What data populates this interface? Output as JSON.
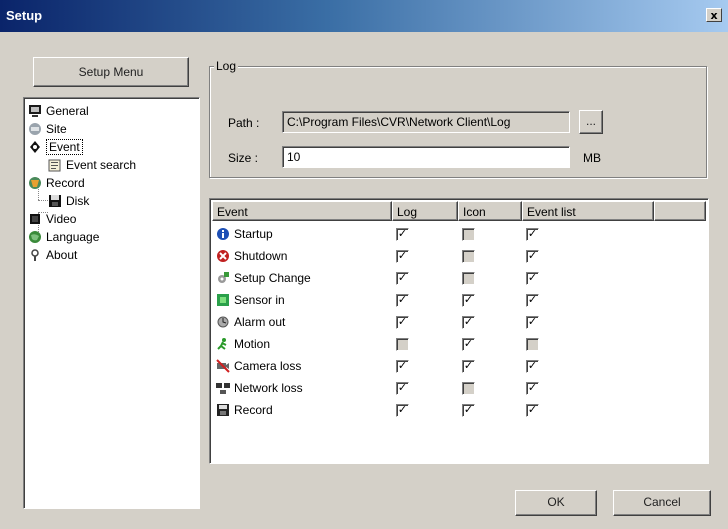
{
  "window": {
    "title": "Setup",
    "close_glyph": "x"
  },
  "setup_menu": {
    "label": "Setup Menu"
  },
  "tree": [
    {
      "label": "General",
      "icon": "monitor-icon",
      "indent": 0
    },
    {
      "label": "Site",
      "icon": "site-icon",
      "indent": 0
    },
    {
      "label": "Event",
      "icon": "event-icon",
      "indent": 0,
      "selected": true
    },
    {
      "label": "Event search",
      "icon": "event-search-icon",
      "indent": 1
    },
    {
      "label": "Record",
      "icon": "record-icon",
      "indent": 0
    },
    {
      "label": "Disk",
      "icon": "disk-icon",
      "indent": 1
    },
    {
      "label": "Video",
      "icon": "video-icon",
      "indent": 0
    },
    {
      "label": "Language",
      "icon": "globe-icon",
      "indent": 0
    },
    {
      "label": "About",
      "icon": "about-icon",
      "indent": 0
    }
  ],
  "log": {
    "group_label": "Log",
    "path_label": "Path :",
    "path_value": "C:\\Program Files\\CVR\\Network Client\\Log",
    "browse_label": "...",
    "size_label": "Size :",
    "size_value": "10",
    "size_unit": "MB"
  },
  "event_list": {
    "columns": [
      "Event",
      "Log",
      "Icon",
      "Event list",
      ""
    ],
    "rows": [
      {
        "name": "Startup",
        "icon": "info-icon",
        "log": true,
        "icon_col": false,
        "event_list": true,
        "log_enabled": true,
        "icon_enabled": false,
        "list_enabled": true
      },
      {
        "name": "Shutdown",
        "icon": "shutdown-icon",
        "log": true,
        "icon_col": false,
        "event_list": true,
        "log_enabled": true,
        "icon_enabled": false,
        "list_enabled": true
      },
      {
        "name": "Setup Change",
        "icon": "setup-change-icon",
        "log": true,
        "icon_col": false,
        "event_list": true,
        "log_enabled": true,
        "icon_enabled": false,
        "list_enabled": true
      },
      {
        "name": "Sensor in",
        "icon": "sensor-icon",
        "log": true,
        "icon_col": true,
        "event_list": true,
        "log_enabled": true,
        "icon_enabled": true,
        "list_enabled": true
      },
      {
        "name": "Alarm out",
        "icon": "alarm-icon",
        "log": true,
        "icon_col": true,
        "event_list": true,
        "log_enabled": true,
        "icon_enabled": true,
        "list_enabled": true
      },
      {
        "name": "Motion",
        "icon": "motion-icon",
        "log": false,
        "icon_col": true,
        "event_list": false,
        "log_enabled": false,
        "icon_enabled": true,
        "list_enabled": false
      },
      {
        "name": "Camera loss",
        "icon": "camera-loss-icon",
        "log": true,
        "icon_col": true,
        "event_list": true,
        "log_enabled": true,
        "icon_enabled": true,
        "list_enabled": true
      },
      {
        "name": "Network loss",
        "icon": "network-loss-icon",
        "log": true,
        "icon_col": false,
        "event_list": true,
        "log_enabled": true,
        "icon_enabled": false,
        "list_enabled": true
      },
      {
        "name": "Record",
        "icon": "record-disk-icon",
        "log": true,
        "icon_col": true,
        "event_list": true,
        "log_enabled": true,
        "icon_enabled": true,
        "list_enabled": true
      }
    ]
  },
  "buttons": {
    "ok": "OK",
    "cancel": "Cancel"
  },
  "colors": {
    "window_bg": "#d4d0c8",
    "title_start": "#0a246a",
    "title_end": "#a6caf0"
  }
}
